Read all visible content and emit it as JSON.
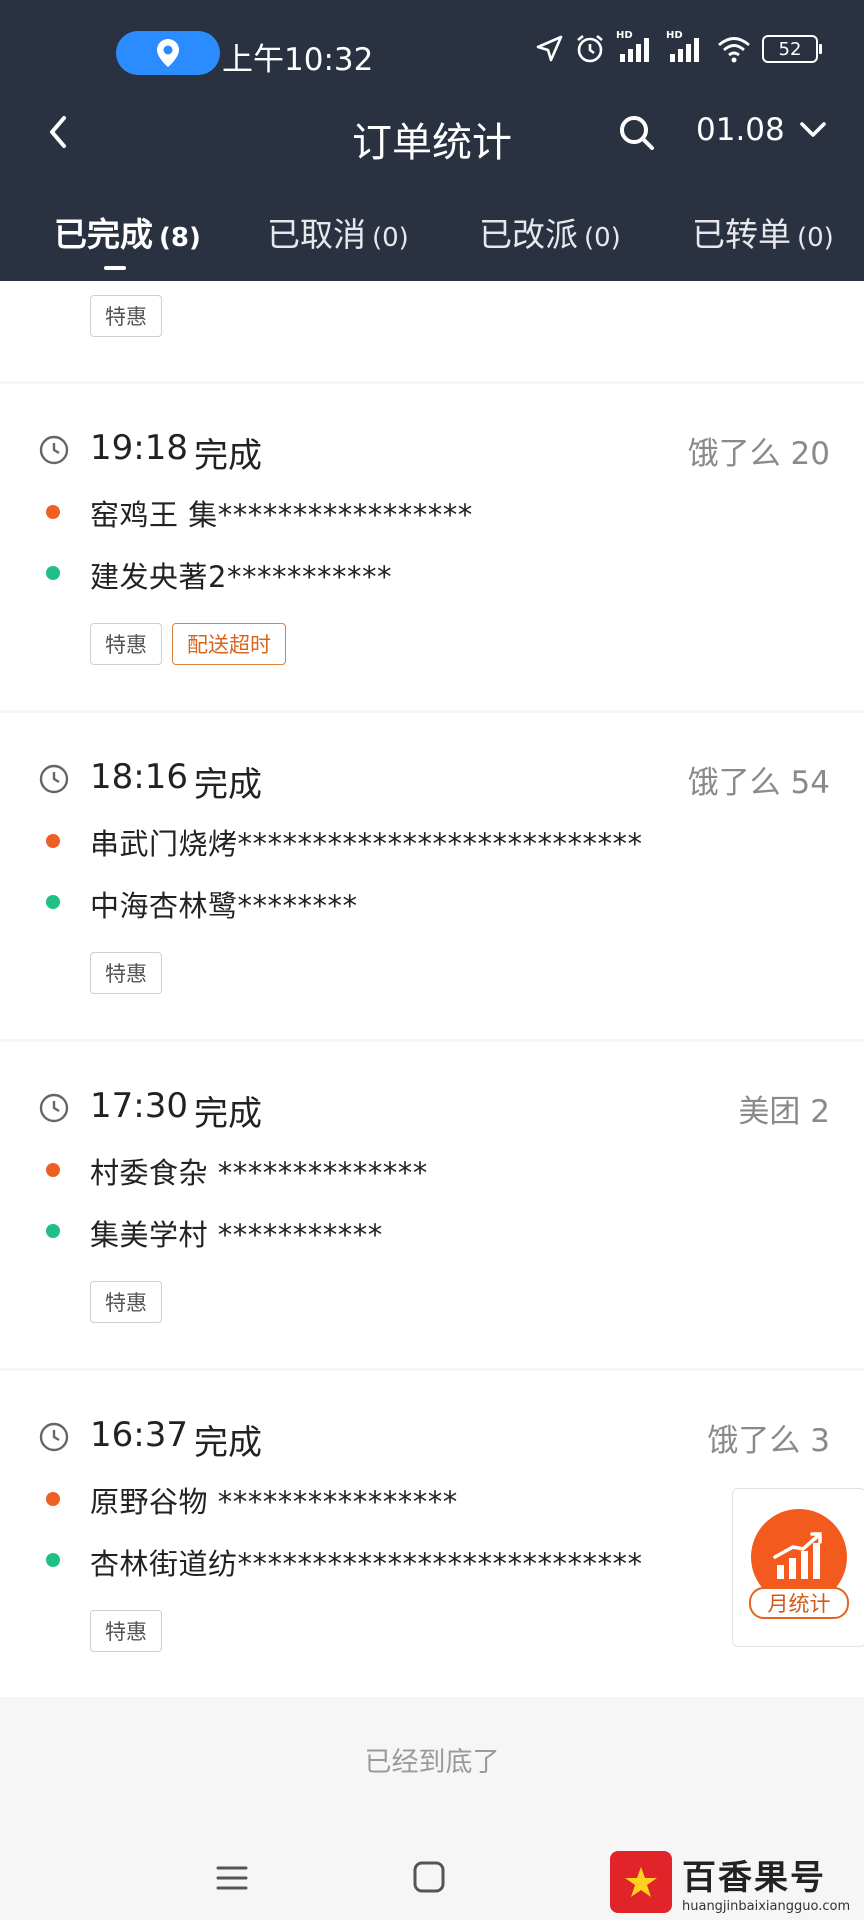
{
  "status_bar": {
    "time": "上午10:32",
    "battery": "52",
    "signal_label_1": "HD",
    "signal_label_2": "HD"
  },
  "navbar": {
    "title": "订单统计",
    "date": "01.08"
  },
  "tabs": [
    {
      "label": "已完成",
      "count": "(8)",
      "active": true
    },
    {
      "label": "已取消",
      "count": "(0)",
      "active": false
    },
    {
      "label": "已改派",
      "count": "(0)",
      "active": false
    },
    {
      "label": "已转单",
      "count": "(0)",
      "active": false
    }
  ],
  "orders": [
    {
      "tags": [
        "特惠"
      ]
    },
    {
      "time": "19:18",
      "status": "完成",
      "source": "饿了么 20",
      "pickup": "窑鸡王 集*****************",
      "dropoff": "建发央著2***********",
      "tags": [
        "特惠",
        "配送超时"
      ]
    },
    {
      "time": "18:16",
      "status": "完成",
      "source": "饿了么 54",
      "pickup": "串武门烧烤***************************",
      "dropoff": "中海杏林鹭********",
      "tags": [
        "特惠"
      ]
    },
    {
      "time": "17:30",
      "status": "完成",
      "source": "美团 2",
      "pickup": "村委食杂 **************",
      "dropoff": "集美学村 ***********",
      "tags": [
        "特惠"
      ]
    },
    {
      "time": "16:37",
      "status": "完成",
      "source": "饿了么 3",
      "pickup": "原野谷物 ****************",
      "dropoff": "杏林街道纺***************************",
      "tags": [
        "特惠"
      ]
    }
  ],
  "footer_note": "已经到底了",
  "monthly_button": {
    "label": "月统计"
  },
  "watermark": {
    "title": "百香果号",
    "url": "huangjinbaixiangguo.com"
  },
  "colors": {
    "header_bg": "#2a3140",
    "pickup_dot": "#ee5f23",
    "dropoff_dot": "#1fbf85",
    "accent": "#f25a1e"
  }
}
